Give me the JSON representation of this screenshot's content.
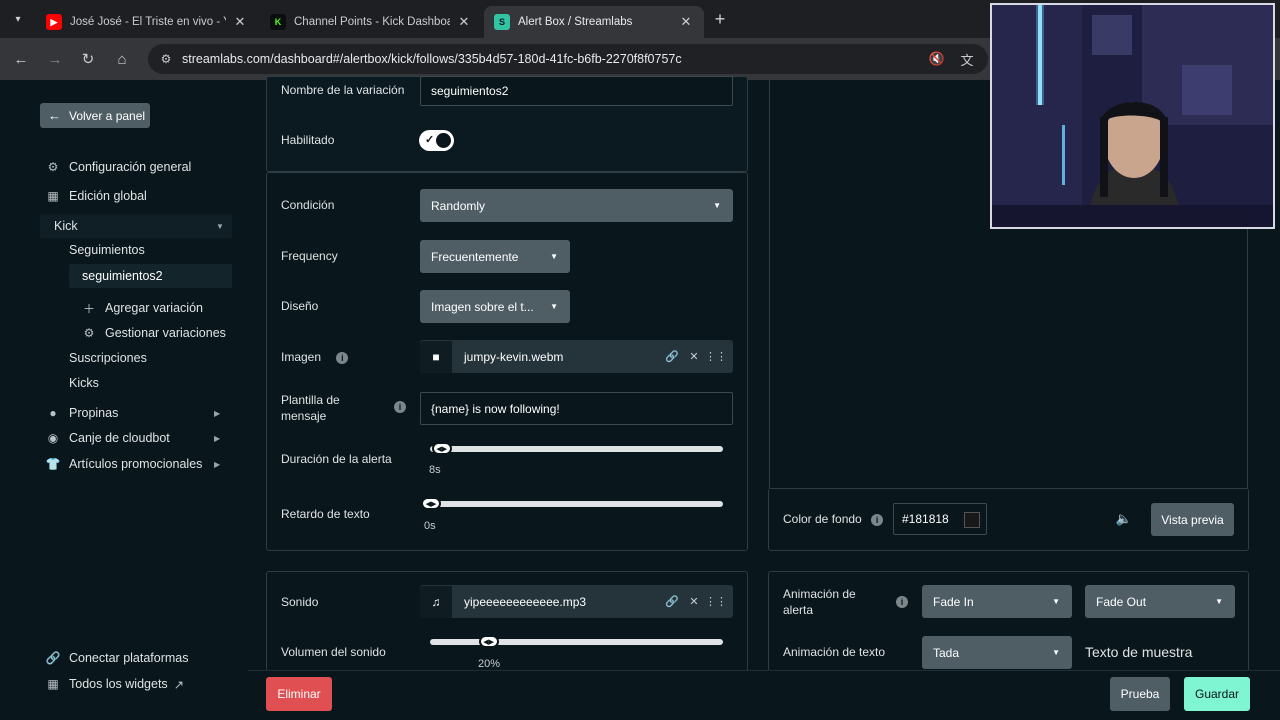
{
  "browser": {
    "tabs": [
      {
        "title": "José José - El Triste en vivo - YouTube",
        "favicon": "youtube-icon",
        "color": "#ff0000"
      },
      {
        "title": "Channel Points - Kick Dashboard",
        "favicon": "kick-icon",
        "color": "#53fc18"
      },
      {
        "title": "Alert Box / Streamlabs",
        "favicon": "streamlabs-icon",
        "color": "#80f5d2"
      }
    ],
    "url": "streamlabs.com/dashboard#/alertbox/kick/follows/335b4d57-180d-41fc-b6fb-2270f8f0757c"
  },
  "sidebar": {
    "back_label": "Volver a panel",
    "general": "Configuración general",
    "global_edit": "Edición global",
    "kick": "Kick",
    "follows": "Seguimientos",
    "variation": "seguimientos2",
    "add_variation": "Agregar variación",
    "manage_variations": "Gestionar variaciones",
    "subs": "Suscripciones",
    "kicks": "Kicks",
    "tips": "Propinas",
    "cloudbot": "Canje de cloudbot",
    "merch": "Artículos promocionales",
    "connect": "Conectar plataformas",
    "all_widgets": "Todos los widgets"
  },
  "form": {
    "variation_name_label": "Nombre de la variación",
    "variation_name_value": "seguimientos2",
    "enabled_label": "Habilitado",
    "enabled": true,
    "condition_label": "Condición",
    "condition_value": "Randomly",
    "frequency_label": "Frequency",
    "frequency_value": "Frecuentemente",
    "design_label": "Diseño",
    "design_value": "Imagen sobre el t...",
    "image_label": "Imagen",
    "image_file": "jumpy-kevin.webm",
    "template_label": "Plantilla de mensaje",
    "template_value": "{name} is now following!",
    "duration_label": "Duración de la alerta",
    "duration_value": "8s",
    "duration_fraction": 0.02,
    "text_delay_label": "Retardo de texto",
    "text_delay_value": "0s",
    "text_delay_fraction": 0.0,
    "sound_label": "Sonido",
    "sound_file": "yipeeeeeeeeeeee.mp3",
    "volume_label": "Volumen del sonido",
    "volume_value": "20%",
    "volume_fraction": 0.2
  },
  "preview": {
    "bg_color_label": "Color de fondo",
    "bg_color_value": "#181818",
    "preview_button": "Vista previa",
    "alert_anim_label": "Animación de alerta",
    "anim_in": "Fade In",
    "anim_out": "Fade Out",
    "text_anim_label": "Animación de texto",
    "text_anim_value": "Tada",
    "sample_text": "Texto de muestra"
  },
  "actions": {
    "delete": "Eliminar",
    "test": "Prueba",
    "save": "Guardar"
  },
  "colors": {
    "accent_green": "#80f5d2",
    "danger_red": "#e04f52",
    "page_bg": "#09161b"
  }
}
